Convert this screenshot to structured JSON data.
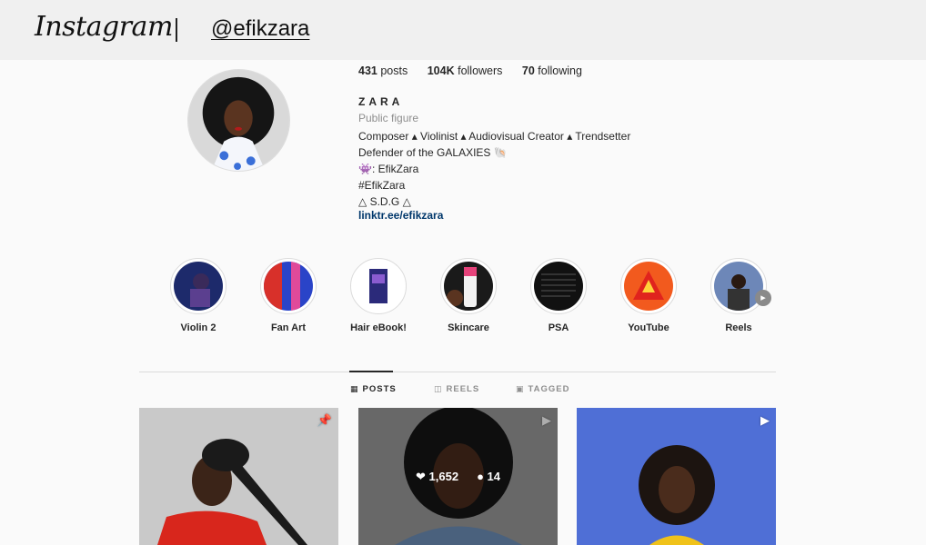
{
  "header": {
    "logo": "Instagram",
    "handle": "@efikzara"
  },
  "profile": {
    "stats": {
      "posts": "431",
      "posts_label": "posts",
      "followers": "104K",
      "followers_label": "followers",
      "following": "70",
      "following_label": "following"
    },
    "name": "ZARA",
    "category": "Public figure",
    "bio": [
      "Composer ▴ Violinist ▴ Audiovisual Creator ▴ Trendsetter",
      "Defender of the GALAXIES 🐚",
      "👾: EfikZara",
      "#EfikZara",
      "△ S.D.G △"
    ],
    "link": "linktr.ee/efikzara"
  },
  "highlights": [
    {
      "label": "Violin 2"
    },
    {
      "label": "Fan Art"
    },
    {
      "label": "Hair eBook!"
    },
    {
      "label": "Skincare"
    },
    {
      "label": "PSA"
    },
    {
      "label": "YouTube"
    },
    {
      "label": "Reels"
    }
  ],
  "tabs": [
    {
      "label": "POSTS",
      "icon": "grid-icon"
    },
    {
      "label": "REELS",
      "icon": "reels-icon"
    },
    {
      "label": "TAGGED",
      "icon": "tagged-icon"
    }
  ],
  "posts": [
    {
      "badge": "pin-icon"
    },
    {
      "badge": "reel-icon",
      "likes": "1,652",
      "comments": "14"
    },
    {
      "badge": "reel-icon"
    }
  ],
  "colors": {
    "link": "#00376b",
    "muted": "#8e8e8e",
    "text": "#262626"
  }
}
